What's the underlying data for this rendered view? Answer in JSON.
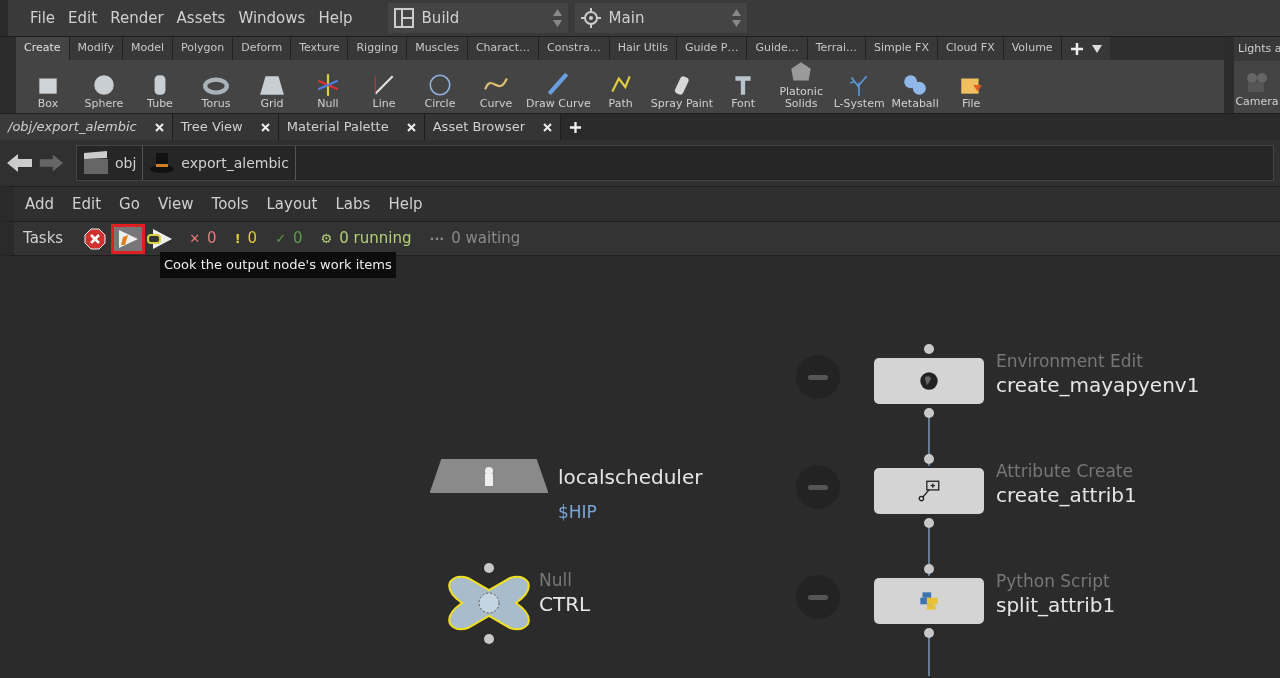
{
  "menu_bar": {
    "items": [
      "File",
      "Edit",
      "Render",
      "Assets",
      "Windows",
      "Help"
    ],
    "desktop": "Build",
    "context": "Main"
  },
  "shelf": {
    "tabs": [
      {
        "label": "Create",
        "selected": true
      },
      {
        "label": "Modify",
        "selected": false
      },
      {
        "label": "Model",
        "selected": false
      },
      {
        "label": "Polygon",
        "selected": false
      },
      {
        "label": "Deform",
        "selected": false
      },
      {
        "label": "Texture",
        "selected": false
      },
      {
        "label": "Rigging",
        "selected": false
      },
      {
        "label": "Muscles",
        "selected": false
      },
      {
        "label": "Charact…",
        "selected": false
      },
      {
        "label": "Constra…",
        "selected": false
      },
      {
        "label": "Hair Utils",
        "selected": false
      },
      {
        "label": "Guide P…",
        "selected": false
      },
      {
        "label": "Guide…",
        "selected": false
      },
      {
        "label": "Terrai…",
        "selected": false
      },
      {
        "label": "Simple FX",
        "selected": false
      },
      {
        "label": "Cloud FX",
        "selected": false
      },
      {
        "label": "Volume",
        "selected": false
      }
    ],
    "tools": [
      "Box",
      "Sphere",
      "Tube",
      "Torus",
      "Grid",
      "Null",
      "Line",
      "Circle",
      "Curve",
      "Draw Curve",
      "Path",
      "Spray Paint",
      "Font",
      "Platonic Solids",
      "L-System",
      "Metaball",
      "File"
    ],
    "side_tab": "Lights a",
    "side_tool": "Camera"
  },
  "pane_tabs": [
    {
      "label": "/obj/export_alembic",
      "selected": true
    },
    {
      "label": "Tree View",
      "selected": false
    },
    {
      "label": "Material Palette",
      "selected": false
    },
    {
      "label": "Asset Browser",
      "selected": false
    }
  ],
  "path": [
    "obj",
    "export_alembic"
  ],
  "network_menu": [
    "Add",
    "Edit",
    "Go",
    "View",
    "Tools",
    "Layout",
    "Labs",
    "Help"
  ],
  "tasks": {
    "label": "Tasks",
    "counts": [
      {
        "glyph": "✕",
        "text": "0",
        "color": "#e07c7c"
      },
      {
        "glyph": "!",
        "text": "0",
        "color": "#e3c93a"
      },
      {
        "glyph": "✓",
        "text": "0",
        "color": "#5f9a4f"
      },
      {
        "glyph": "⚙",
        "text": "0 running",
        "color": "#b5d17a"
      },
      {
        "glyph": "···",
        "text": "0 waiting",
        "color": "#8a8a8a"
      }
    ],
    "tooltip": "Cook the output node's work items"
  },
  "nodes": [
    {
      "kind": "top",
      "type": "Environment Edit",
      "name": "create_mayapyenv1",
      "selected": false
    },
    {
      "kind": "scheduler",
      "name": "localscheduler",
      "path": "$HIP",
      "selected": false
    },
    {
      "kind": "top",
      "type": "Attribute Create",
      "name": "create_attrib1",
      "selected": false
    },
    {
      "kind": "null",
      "type": "Null",
      "name": "CTRL",
      "selected": true
    },
    {
      "kind": "top",
      "type": "Python Script",
      "name": "split_attrib1",
      "selected": false
    }
  ]
}
